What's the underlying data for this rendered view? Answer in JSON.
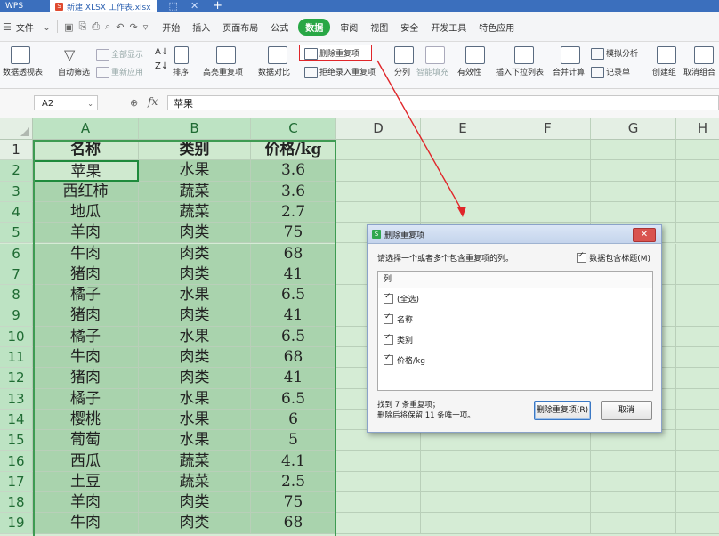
{
  "titlebar": {
    "app_name": "WPS",
    "tab_icon": "S",
    "tab_title": "新建 XLSX 工作表.xlsx",
    "pin_icon": "⬚",
    "close_icon": "✕",
    "plus_icon": "+"
  },
  "menubar": {
    "file_label": "文件",
    "items": [
      "开始",
      "插入",
      "页面布局",
      "公式",
      "数据",
      "审阅",
      "视图",
      "安全",
      "开发工具",
      "特色应用"
    ],
    "active_item": "数据"
  },
  "ribbon": {
    "pivot": "数据透视表",
    "autofilter": "自动筛选",
    "show_all": "全部显示",
    "reapply": "重新应用",
    "sort": "排序",
    "highlight_dup": "高亮重复项",
    "compare": "数据对比",
    "remove_dup": "删除重复项",
    "reject_dup": "拒绝录入重复项",
    "split": "分列",
    "smart_fill": "智能填充",
    "validity": "有效性",
    "dropdown_list": "插入下拉列表",
    "consolidate": "合并计算",
    "what_if": "模拟分析",
    "record_form": "记录单",
    "group": "创建组",
    "ungroup": "取消组合"
  },
  "formula_bar": {
    "cell_ref": "A2",
    "fx": "fx",
    "value": "苹果"
  },
  "sheet": {
    "columns": [
      "A",
      "B",
      "C",
      "D",
      "E",
      "F",
      "G",
      "H"
    ],
    "rows": [
      "1",
      "2",
      "3",
      "4",
      "5",
      "6",
      "7",
      "8",
      "9",
      "10",
      "11",
      "12",
      "13",
      "14",
      "15",
      "16",
      "17",
      "18",
      "19"
    ],
    "headers": [
      "名称",
      "类别",
      "价格/kg"
    ],
    "data": [
      [
        "苹果",
        "水果",
        "3.6"
      ],
      [
        "西红柿",
        "蔬菜",
        "3.6"
      ],
      [
        "地瓜",
        "蔬菜",
        "2.7"
      ],
      [
        "羊肉",
        "肉类",
        "75"
      ],
      [
        "牛肉",
        "肉类",
        "68"
      ],
      [
        "猪肉",
        "肉类",
        "41"
      ],
      [
        "橘子",
        "水果",
        "6.5"
      ],
      [
        "猪肉",
        "肉类",
        "41"
      ],
      [
        "橘子",
        "水果",
        "6.5"
      ],
      [
        "牛肉",
        "肉类",
        "68"
      ],
      [
        "猪肉",
        "肉类",
        "41"
      ],
      [
        "橘子",
        "水果",
        "6.5"
      ],
      [
        "樱桃",
        "水果",
        "6"
      ],
      [
        "葡萄",
        "水果",
        "5"
      ],
      [
        "西瓜",
        "蔬菜",
        "4.1"
      ],
      [
        "土豆",
        "蔬菜",
        "2.5"
      ],
      [
        "羊肉",
        "肉类",
        "75"
      ],
      [
        "牛肉",
        "肉类",
        "68"
      ]
    ]
  },
  "dialog": {
    "title": "删除重复项",
    "prompt": "请选择一个或者多个包含重复项的列。",
    "header_checkbox": "数据包含标题(M)",
    "list_header": "列",
    "columns": [
      "(全选)",
      "名称",
      "类别",
      "价格/kg"
    ],
    "result_line1": "找到 7 条重复项；",
    "result_line2": "删除后将保留 11 条唯一项。",
    "ok_button": "删除重复项(R)",
    "cancel_button": "取消"
  },
  "colors": {
    "accent_green": "#28a745",
    "annotation_red": "#e0262a",
    "title_blue": "#3b6fbd"
  }
}
